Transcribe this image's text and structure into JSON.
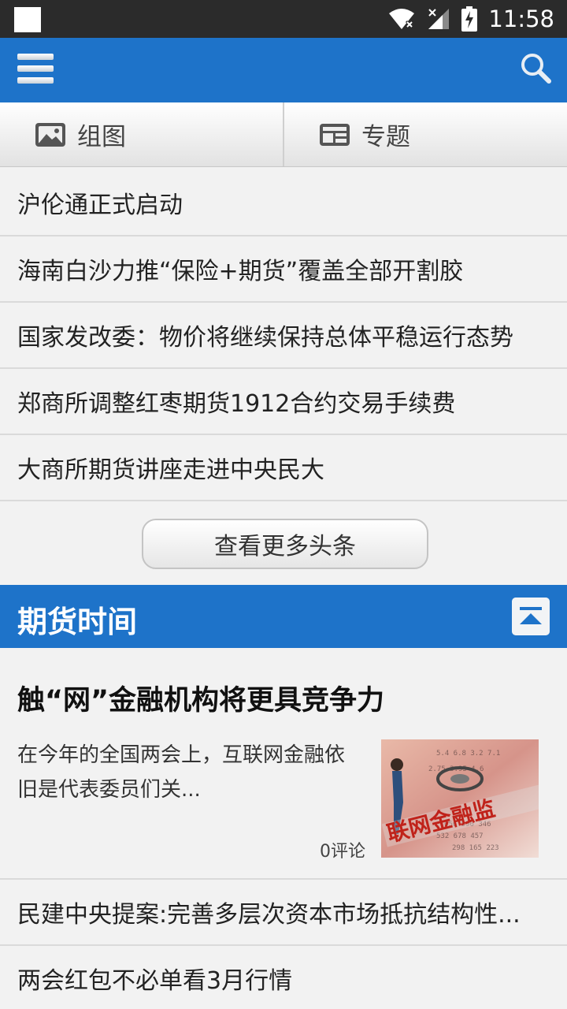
{
  "status_bar": {
    "time": "11:58"
  },
  "tabs": [
    {
      "label": "组图",
      "icon": "image-icon"
    },
    {
      "label": "专题",
      "icon": "news-icon"
    }
  ],
  "headlines": [
    "沪伦通正式启动",
    "海南白沙力推“保险+期货”覆盖全部开割胶",
    "国家发改委：物价将继续保持总体平稳运行态势",
    "郑商所调整红枣期货1912合约交易手续费",
    "大商所期货讲座走进中央民大"
  ],
  "more_button": "查看更多头条",
  "section": {
    "title": "期货时间"
  },
  "feature": {
    "title": "触“网”金融机构将更具竞争力",
    "summary": "在今年的全国两会上，互联网金融依旧是代表委员们关...",
    "comments": "0评论",
    "image_text": "联网金融监"
  },
  "more_news": [
    "民建中央提案:完善多层次资本市场抵抗结构性...",
    "两会红包不必单看3月行情"
  ],
  "colors": {
    "primary": "#1e73c9",
    "statusbar": "#2b2b2b",
    "background": "#f2f2f2"
  }
}
